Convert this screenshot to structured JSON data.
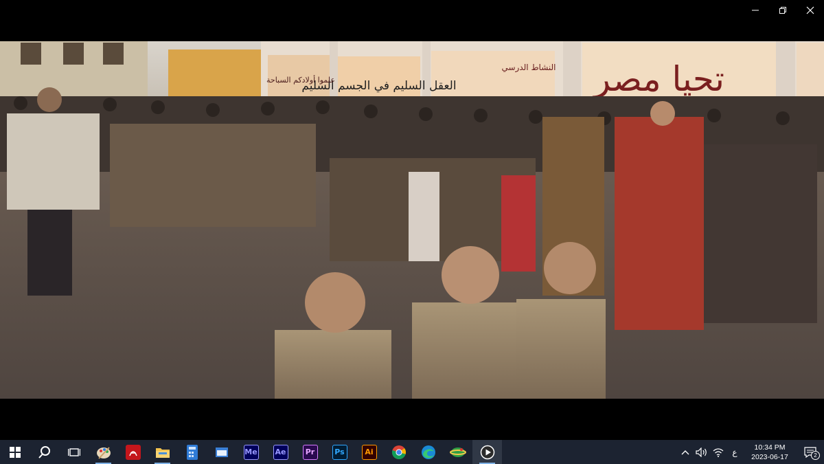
{
  "window": {
    "controls": {
      "minimize": "minimize",
      "restore": "restore",
      "close": "close"
    },
    "background": "#000000"
  },
  "video": {
    "wall_text": {
      "banner_1": "تحيا مصر",
      "banner_2": "العقل السليم في الجسم السليم",
      "banner_3": "النشاط الدرسي",
      "banner_4": "علموا أولادكم السباحة"
    }
  },
  "taskbar": {
    "background": "#1c2331",
    "items": [
      {
        "name": "start",
        "icon": "windows-logo-icon"
      },
      {
        "name": "search",
        "icon": "search-icon"
      },
      {
        "name": "task-view",
        "icon": "task-view-icon"
      },
      {
        "name": "paint",
        "icon": "paint-palette-icon",
        "running": true
      },
      {
        "name": "acrobat",
        "icon": "acrobat-icon"
      },
      {
        "name": "file-explorer",
        "icon": "folder-icon",
        "running": true
      },
      {
        "name": "calculator",
        "icon": "calculator-icon"
      },
      {
        "name": "window-app",
        "icon": "window-icon"
      },
      {
        "name": "media-encoder",
        "icon": "media-encoder-icon",
        "label": "Me"
      },
      {
        "name": "after-effects",
        "icon": "after-effects-icon",
        "label": "Ae"
      },
      {
        "name": "premiere",
        "icon": "premiere-icon",
        "label": "Pr"
      },
      {
        "name": "photoshop",
        "icon": "photoshop-icon",
        "label": "Ps"
      },
      {
        "name": "illustrator",
        "icon": "illustrator-icon",
        "label": "Ai"
      },
      {
        "name": "chrome",
        "icon": "chrome-icon"
      },
      {
        "name": "edge",
        "icon": "edge-icon"
      },
      {
        "name": "green-app",
        "icon": "green-globe-icon"
      },
      {
        "name": "media-player",
        "icon": "media-player-icon",
        "active": true,
        "running": true
      }
    ],
    "tray": {
      "language": "ع",
      "time": "10:34 PM",
      "date": "2023-06-17",
      "notification_count": "2"
    }
  }
}
